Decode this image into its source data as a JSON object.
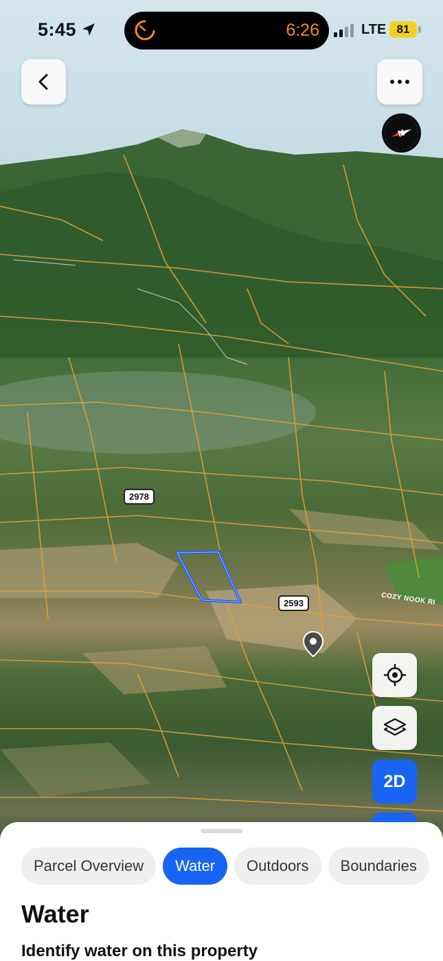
{
  "status_bar": {
    "time": "5:45",
    "island_time": "6:26",
    "network": "LTE",
    "battery": "81"
  },
  "map": {
    "road_labels": [
      "2978",
      "2593"
    ],
    "street_labels": [
      "COZY NOOK RI"
    ],
    "parcel_outline_color": "#1a5cff",
    "parcel_line_color": "#e0a23a",
    "view_mode_label": "2D"
  },
  "controls": {
    "back_icon": "chevron-left-icon",
    "more_icon": "ellipsis-icon",
    "compass_icon": "compass-icon",
    "locate_icon": "crosshair-icon",
    "layers_icon": "layers-icon"
  },
  "sheet": {
    "tabs": [
      {
        "label": "Parcel Overview",
        "active": false
      },
      {
        "label": "Water",
        "active": true
      },
      {
        "label": "Outdoors",
        "active": false
      },
      {
        "label": "Boundaries",
        "active": false
      }
    ],
    "title": "Water",
    "subtitle": "Identify water on this property"
  },
  "colors": {
    "accent": "#1765f2",
    "island_timer": "#f08a24",
    "battery": "#f5d020"
  }
}
